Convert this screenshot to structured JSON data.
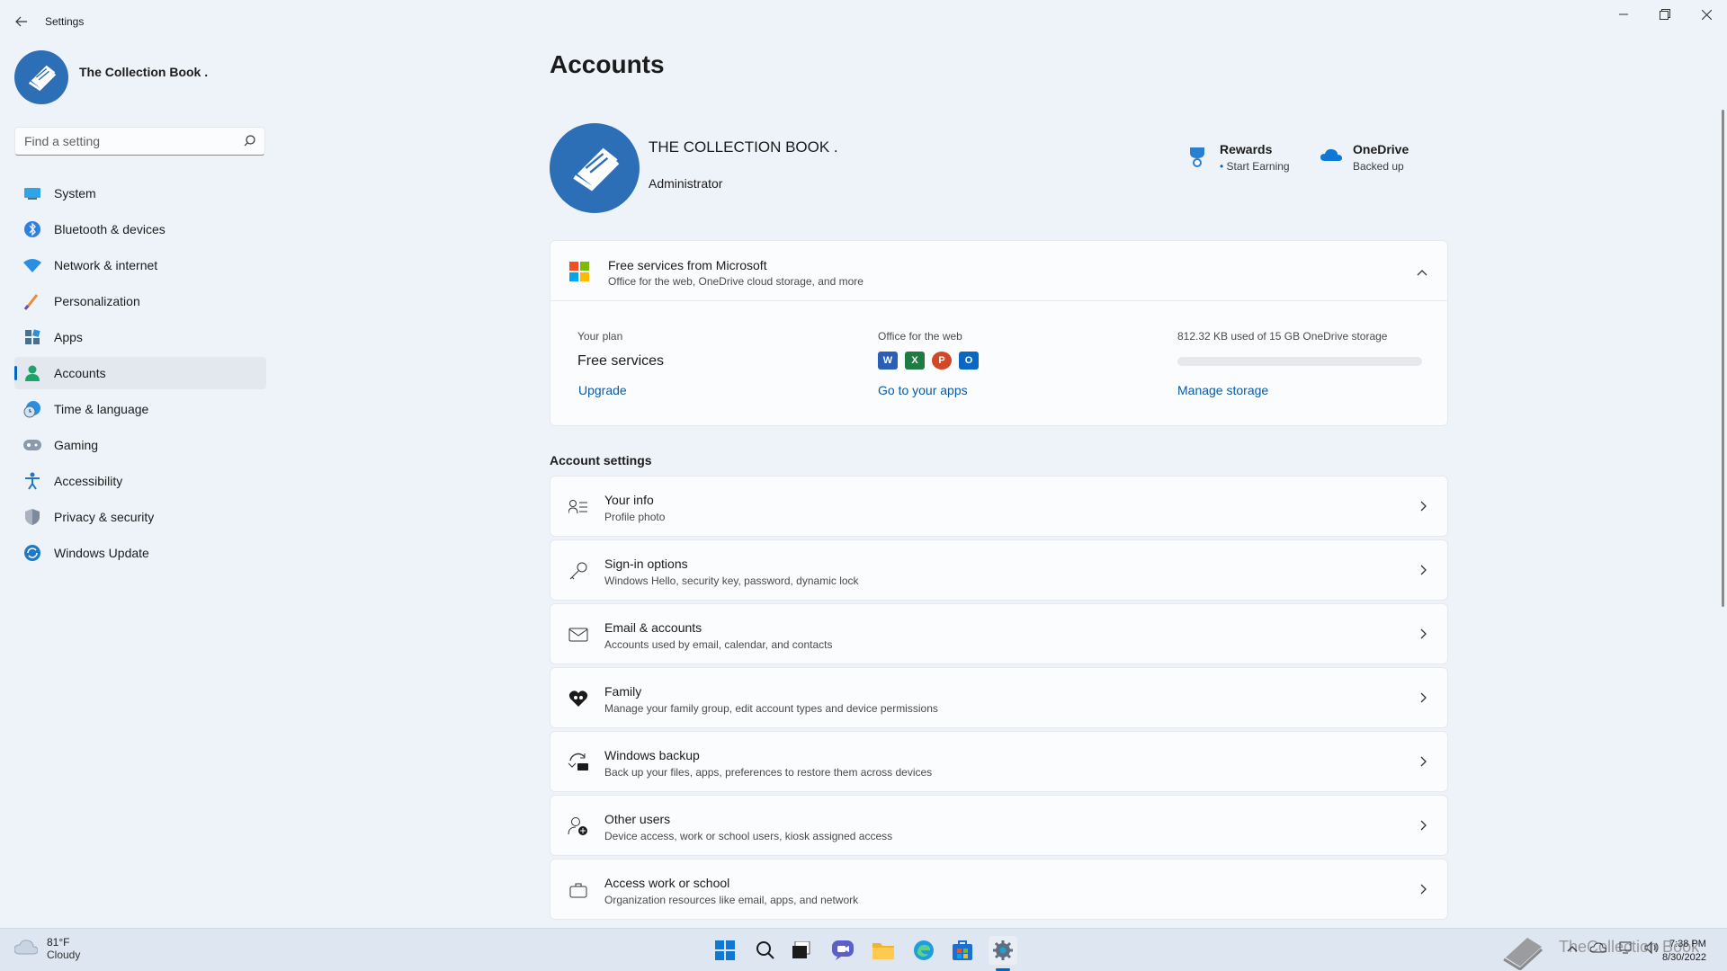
{
  "window": {
    "title": "Settings"
  },
  "profile": {
    "name": "The Collection Book .",
    "display_name": "THE COLLECTION BOOK .",
    "role": "Administrator"
  },
  "search": {
    "placeholder": "Find a setting"
  },
  "nav": {
    "items": [
      {
        "label": "System",
        "icon": "system-icon"
      },
      {
        "label": "Bluetooth & devices",
        "icon": "bluetooth-icon"
      },
      {
        "label": "Network & internet",
        "icon": "wifi-icon"
      },
      {
        "label": "Personalization",
        "icon": "brush-icon"
      },
      {
        "label": "Apps",
        "icon": "apps-icon"
      },
      {
        "label": "Accounts",
        "icon": "accounts-icon",
        "active": true
      },
      {
        "label": "Time & language",
        "icon": "clock-globe-icon"
      },
      {
        "label": "Gaming",
        "icon": "gamepad-icon"
      },
      {
        "label": "Accessibility",
        "icon": "accessibility-icon"
      },
      {
        "label": "Privacy & security",
        "icon": "shield-icon"
      },
      {
        "label": "Windows Update",
        "icon": "update-icon"
      }
    ]
  },
  "main": {
    "title": "Accounts",
    "rewards": {
      "title": "Rewards",
      "sub": "Start Earning"
    },
    "onedrive": {
      "title": "OneDrive",
      "sub": "Backed up"
    },
    "ms_services": {
      "title": "Free services from Microsoft",
      "sub": "Office for the web, OneDrive cloud storage, and more",
      "plan_label": "Your plan",
      "plan_value": "Free services",
      "plan_link": "Upgrade",
      "office_label": "Office for the web",
      "office_link": "Go to your apps",
      "storage_label": "812.32 KB used of 15 GB OneDrive storage",
      "storage_used_fraction": 0.0001,
      "storage_link": "Manage storage"
    },
    "section_title": "Account settings",
    "settings": [
      {
        "title": "Your info",
        "sub": "Profile photo",
        "icon": "person-list-icon"
      },
      {
        "title": "Sign-in options",
        "sub": "Windows Hello, security key, password, dynamic lock",
        "icon": "key-icon"
      },
      {
        "title": "Email & accounts",
        "sub": "Accounts used by email, calendar, and contacts",
        "icon": "mail-icon"
      },
      {
        "title": "Family",
        "sub": "Manage your family group, edit account types and device permissions",
        "icon": "heart-people-icon"
      },
      {
        "title": "Windows backup",
        "sub": "Back up your files, apps, preferences to restore them across devices",
        "icon": "backup-icon"
      },
      {
        "title": "Other users",
        "sub": "Device access, work or school users, kiosk assigned access",
        "icon": "add-person-icon"
      },
      {
        "title": "Access work or school",
        "sub": "Organization resources like email, apps, and network",
        "icon": "briefcase-icon"
      }
    ]
  },
  "taskbar": {
    "weather_temp": "81°F",
    "weather_desc": "Cloudy",
    "time": "7:38 PM",
    "date": "8/30/2022",
    "watermark": "TheCollection Book"
  },
  "colors": {
    "accent": "#0067c0",
    "avatar": "#2c6fb7"
  }
}
